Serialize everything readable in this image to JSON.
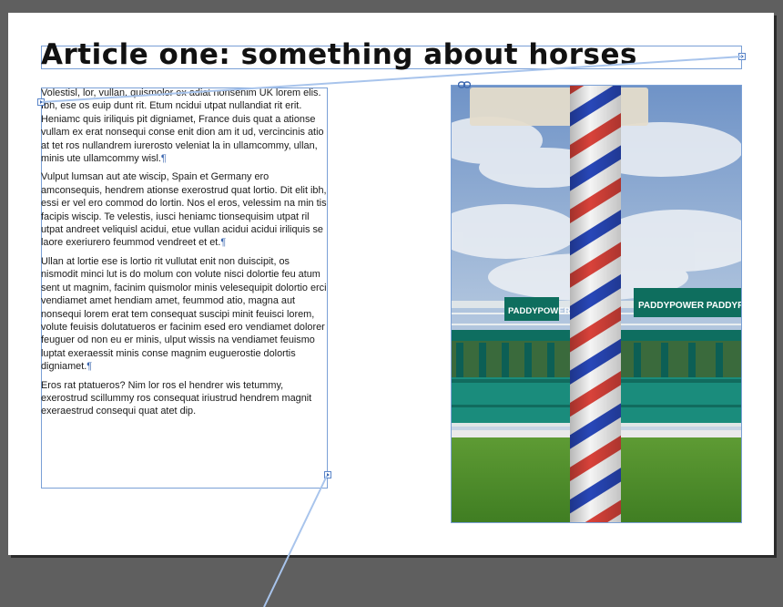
{
  "title": "Article one: something about horses",
  "paragraphs": [
    "Volestisl, lor, vullan, quismolor ex adiat nonsenim UK lorem elis. Ibh, ese os euip dunt rit. Etum ncidui utpat nullandiat rit erit. Heniamc quis iriliquis pit digniamet, France duis quat a ationse vullam ex erat nonsequi conse enit dion am it ud, vercincinis atio at tet ros nullandrem iurerosto veleniat la in ullamcommy, ullan, minis ute ullamcommy wisl.",
    "Vulput lumsan aut ate wiscip, Spain et Germany ero amconsequis, hendrem ationse exerostrud quat lortio. Dit elit ibh, essi er vel ero commod do lortin. Nos el eros, velessim na min tis facipis wiscip. Te velestis, iusci heniamc tionsequisim utpat ril utpat andreet veliquisl acidui, etue vullan acidui acidui iriliquis se laore exeriurero feummod vendreet et et.",
    "Ullan at lortie ese is lortio rit vullutat enit non duiscipit, os nismodit minci lut is do molum con volute nisci dolortie feu atum sent ut magnim, facinim quismolor minis velesequipit dolortio erci vendiamet amet hendiam amet, feummod atio, magna aut nonsequi lorem erat tem consequat suscipi minit feuisci lorem, volute feuisis dolutatueros er facinim esed ero vendiamet dolorer feuguer od non eu er minis, ulput wissis na vendiamet feuismo luptat exeraessit minis conse magnim euguerostie dolortis digniamet.",
    "Eros rat ptatueros? Nim lor ros el hendrer wis tetummy, exerostrud scillummy ros consequat iriustrud hendrem magnit exeraestrud consequi quat atet dip."
  ],
  "pilcrow": "¶",
  "image": {
    "sign_left": "PADDYPOWER",
    "sign_right": "PADDYPOWER  PADDYPOV"
  },
  "colors": {
    "frame": "#7aa0d6",
    "thread": "#a8c4ec",
    "spell_error": "#e04646",
    "pasteboard": "#5f5f5f"
  }
}
